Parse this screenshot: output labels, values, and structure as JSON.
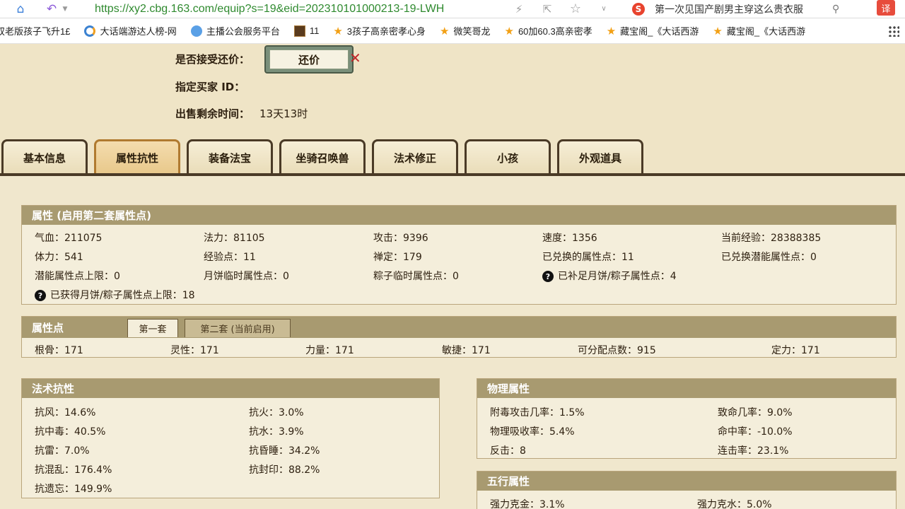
{
  "browser": {
    "url": "https://xy2.cbg.163.com/equip?s=19&eid=202310101000213-19-LWH",
    "search_text": "第一次见国产剧男主穿这么贵衣服",
    "ext_label": "译"
  },
  "bookmarks": [
    {
      "label": "双老版孩子飞升1£",
      "icon": "none"
    },
    {
      "label": "大话端游达人榜-网",
      "icon": "globe"
    },
    {
      "label": "主播公会服务平台",
      "icon": "cloud"
    },
    {
      "label": "11",
      "icon": "game"
    },
    {
      "label": "3孩子高亲密孝心身",
      "icon": "star"
    },
    {
      "label": "微笑哥龙",
      "icon": "star"
    },
    {
      "label": "60加60.3高亲密孝",
      "icon": "star"
    },
    {
      "label": "藏宝阁_《大话西游",
      "icon": "star"
    },
    {
      "label": "藏宝阁_《大话西游",
      "icon": "star"
    }
  ],
  "sale": {
    "accept_counter_label": "是否接受还价：",
    "counter_button": "还价",
    "buyer_id_label": "指定买家 ID：",
    "remaining_label": "出售剩余时间：",
    "remaining_value": "13天13时"
  },
  "tabs": [
    "基本信息",
    "属性抗性",
    "装备法宝",
    "坐骑召唤兽",
    "法术修正",
    "小孩",
    "外观道具"
  ],
  "attributes": {
    "title": "属性 (启用第二套属性点)",
    "cells": [
      "气血：211075",
      "法力：81105",
      "攻击：9396",
      "速度：1356",
      "当前经验：28388385",
      "体力：541",
      "经验点：11",
      "禅定：179",
      "已兑换的属性点：11",
      "已兑换潜能属性点：0",
      "潜能属性点上限：0",
      "月饼临时属性点：0",
      "粽子临时属性点：0",
      "已补足月饼/粽子属性点：4",
      "已获得月饼/粽子属性点上限：18"
    ]
  },
  "points": {
    "title": "属性点",
    "set1": "第一套",
    "set2": "第二套 (当前启用)",
    "cells": [
      "根骨：171",
      "灵性：171",
      "力量：171",
      "敏捷：171",
      "可分配点数：915",
      "定力：171"
    ]
  },
  "resist": {
    "title": "法术抗性",
    "cells": [
      "抗风：14.6%",
      "抗火：3.0%",
      "抗中毒：40.5%",
      "抗水：3.9%",
      "抗雷：7.0%",
      "抗昏睡：34.2%",
      "抗混乱：176.4%",
      "抗封印：88.2%",
      "抗遗忘：149.9%"
    ]
  },
  "physical": {
    "title": "物理属性",
    "cells": [
      "附毒攻击几率：1.5%",
      "致命几率：9.0%",
      "物理吸收率：5.4%",
      "命中率：-10.0%",
      "反击：8",
      "连击率：23.1%"
    ]
  },
  "elements": {
    "title": "五行属性",
    "cells": [
      "强力克金：3.1%",
      "强力克水：5.0%"
    ]
  }
}
